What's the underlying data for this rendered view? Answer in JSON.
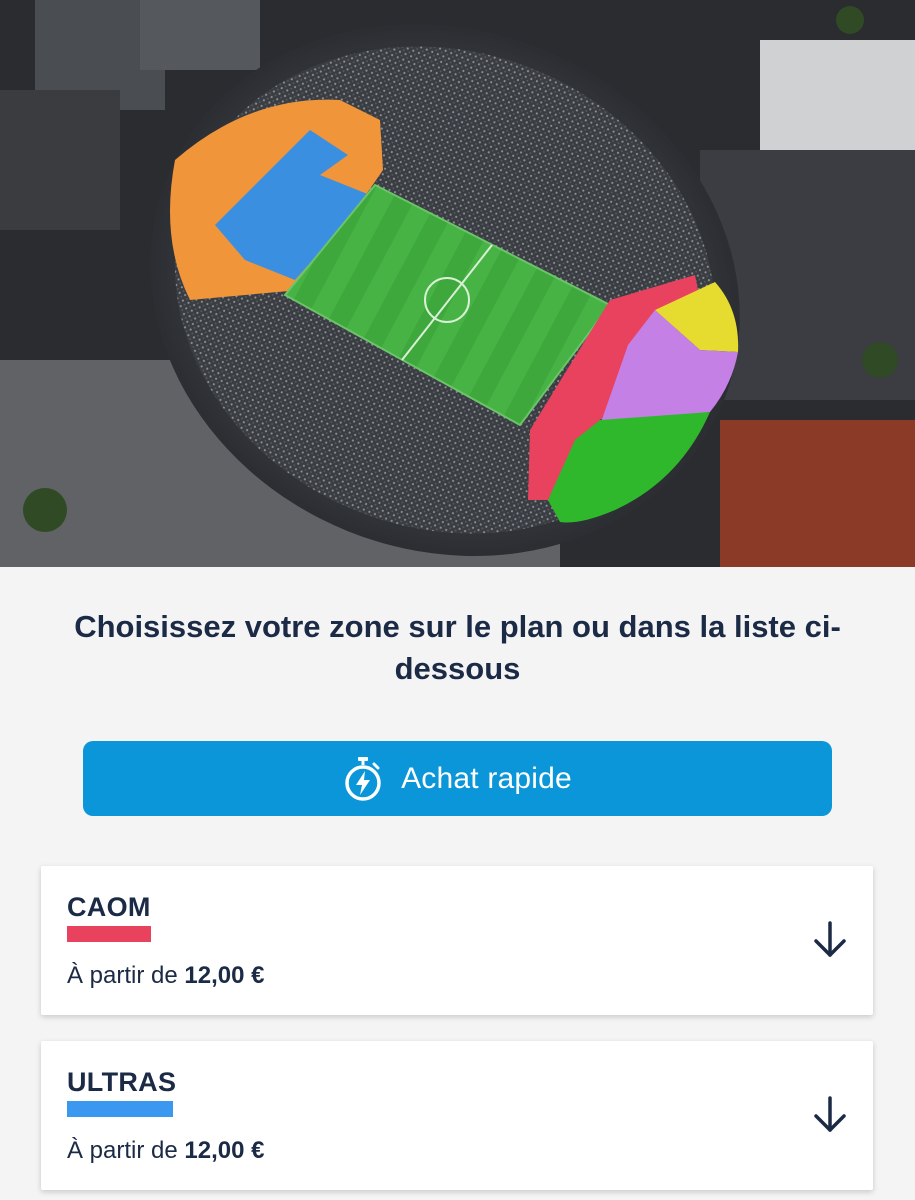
{
  "map": {
    "colors": {
      "orange": "#f0953a",
      "blue": "#3b8fe0",
      "red": "#e8425f",
      "yellow": "#e6dc2f",
      "purple": "#c580e6",
      "green": "#2fb82c",
      "pitch": "#3ea83c"
    }
  },
  "instruction": "Choisissez votre zone sur le plan ou dans la liste ci-dessous",
  "quick_buy": {
    "label": "Achat rapide",
    "icon": "stopwatch-lightning-icon",
    "color": "#0a96d8"
  },
  "zones": [
    {
      "name": "CAOM",
      "color": "#e8425f",
      "price_prefix": "À partir de",
      "price": "12,00 €",
      "icon": "arrow-down-icon"
    },
    {
      "name": "ULTRAS",
      "color": "#3b98f0",
      "price_prefix": "À partir de",
      "price": "12,00 €",
      "icon": "arrow-down-icon"
    }
  ]
}
